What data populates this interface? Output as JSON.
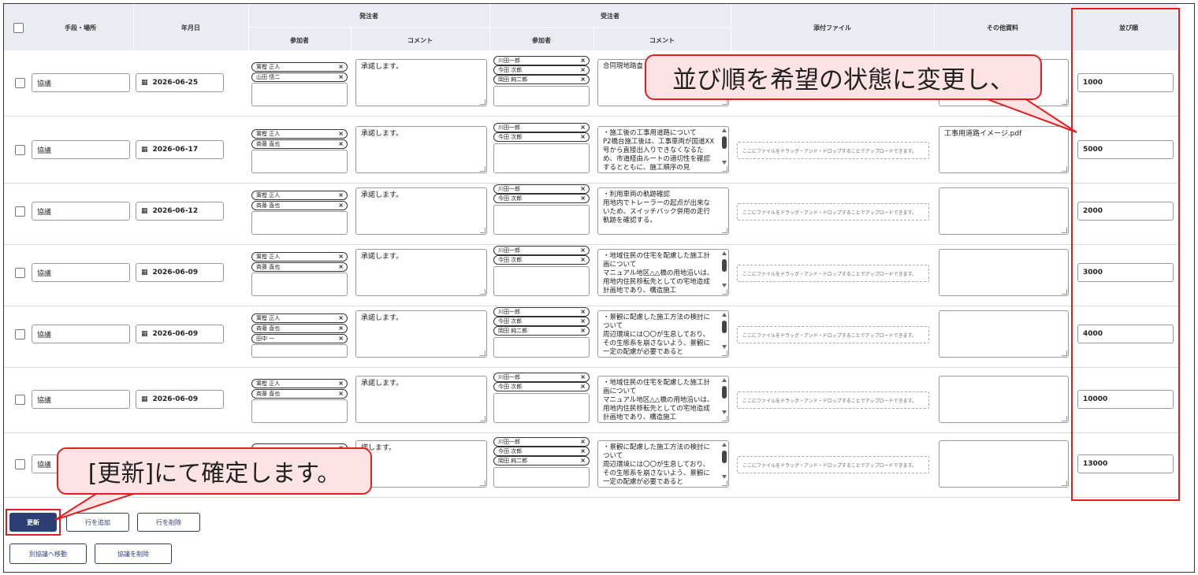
{
  "header": {
    "select_all": "",
    "col_method": "手段・場所",
    "col_date": "年月日",
    "group_orderer": "発注者",
    "group_contractor": "受注者",
    "col_participants": "参加者",
    "col_comment": "コメント",
    "col_participants2": "参加者",
    "col_comment2": "コメント",
    "col_attachment": "添付ファイル",
    "col_other": "その他資料",
    "col_order": "並び順"
  },
  "drop_text": "ここにファイルをドラッグ・アンド・ドロップすることでアップロードできます。",
  "rows": [
    {
      "method": "協議",
      "date": "2026-06-25",
      "orderer": [
        "寓樫 正人",
        "山田 悟二"
      ],
      "comment": "承諾します。",
      "contractor": [
        "川田一郎",
        "今田 次郎",
        "岡田 純二郎"
      ],
      "contractor_comment": "合同現地踏査",
      "scroll": false,
      "attachment": null,
      "other": "",
      "order": "1000"
    },
    {
      "method": "協議",
      "date": "2026-06-17",
      "orderer": [
        "寓樫 正人",
        "斉藤 直也"
      ],
      "comment": "承諾します。",
      "contractor": [
        "川田一郎",
        "今田 次郎"
      ],
      "contractor_comment": "・施工後の工事用道路について\nP2橋台施工後は、工事車両が国道XX号から直接出入りできなくなるため、市道経由ルートの適切性を確認するとともに、施工順序の見",
      "scroll": true,
      "attachment": "drop",
      "other": "工事用道路イメージ.pdf",
      "order": "5000"
    },
    {
      "method": "協議",
      "date": "2026-06-12",
      "orderer": [
        "寓樫 正人",
        "斉藤 直也"
      ],
      "comment": "承諾します。",
      "contractor": [
        "川田一郎",
        "今田 次郎"
      ],
      "contractor_comment": "・利用車両の軌跡確認\n用地内でトレーラーの起点が出来ないため、スイッチバック併用の走行軌跡を確認する。",
      "scroll": false,
      "attachment": "drop",
      "other": "",
      "order": "2000"
    },
    {
      "method": "協議",
      "date": "2026-06-09",
      "orderer": [
        "寓樫 正人",
        "斉藤 直也"
      ],
      "comment": "承諾します。",
      "contractor": [
        "川田一郎",
        "今田 次郎"
      ],
      "contractor_comment": "・地域住民の住宅を配慮した施工計画について\nマニュアル地区△△橋の用地沿いは、用地内住民移転先としての宅地造成計画地であり、構造施工",
      "scroll": true,
      "attachment": "drop",
      "other": "",
      "order": "3000"
    },
    {
      "method": "協議",
      "date": "2026-06-09",
      "orderer": [
        "寓樫 正人",
        "斉藤 直也",
        "田中 一"
      ],
      "comment": "承諾します。",
      "contractor": [
        "川田一郎",
        "今田 次郎",
        "岡田 純二郎"
      ],
      "contractor_comment": "・景観に配慮した施工方法の検討について\n周辺環境には〇〇が生息しており、その生態系を崩さないよう、景観に一定の配慮が必要であると",
      "scroll": true,
      "attachment": "drop",
      "other": "",
      "order": "4000"
    },
    {
      "method": "協議",
      "date": "2026-06-09",
      "orderer": [
        "寓樫 正人",
        "斉藤 直也"
      ],
      "comment": "承諾します。",
      "contractor": [
        "川田一郎",
        "今田 次郎"
      ],
      "contractor_comment": "・地域住民の住宅を配慮した施工計画について\nマニュアル地区△△橋の用地沿いは、用地内住民移転先としての宅地造成計画地であり、構造施工",
      "scroll": true,
      "attachment": "drop",
      "other": "",
      "order": "10000"
    },
    {
      "method": "協議",
      "date": "",
      "orderer": [
        "",
        ""
      ],
      "comment": "諾します。",
      "contractor": [
        "川田一郎",
        "今田 次郎",
        "岡田 純二郎"
      ],
      "contractor_comment": "・景観に配慮した施工方法の検討について\n周辺環境には〇〇が生息しており、その生態系を崩さないよう、景観に一定の配慮が必要であると",
      "scroll": true,
      "attachment": "drop",
      "other": "",
      "order": "13000"
    }
  ],
  "buttons": {
    "update": "更新",
    "add_row": "行を追加",
    "delete_row": "行を削除",
    "move_other": "別協議へ移動",
    "delete_consultation": "協議を削除"
  },
  "callouts": {
    "order_hint": "並び順を希望の状態に変更し、",
    "update_hint": "[更新]にて確定します。"
  },
  "colors": {
    "accent": "#e02020",
    "callout_bg": "#fde3e3",
    "primary": "#2c3e74",
    "header_bg": "#e9ecf3"
  }
}
